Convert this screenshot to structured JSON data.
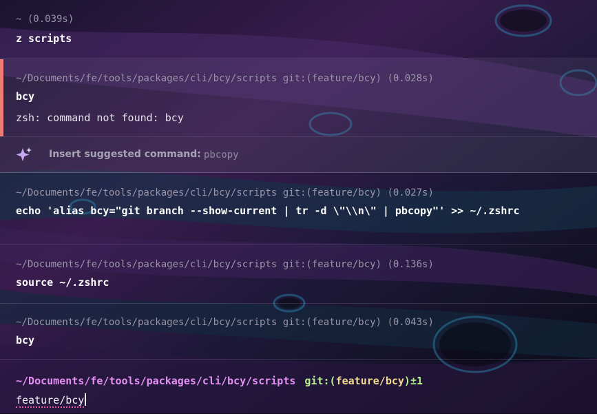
{
  "blocks": [
    {
      "meta": "~ (0.039s)",
      "command": "z scripts"
    },
    {
      "meta": "~/Documents/fe/tools/packages/cli/bcy/scripts git:(feature/bcy) (0.028s)",
      "command": "bcy",
      "output": "zsh: command not found: bcy"
    },
    {
      "meta": "~/Documents/fe/tools/packages/cli/bcy/scripts git:(feature/bcy) (0.027s)",
      "command": "echo 'alias bcy=\"git branch --show-current | tr -d \\\"\\\\n\\\" | pbcopy\"' >> ~/.zshrc"
    },
    {
      "meta": "~/Documents/fe/tools/packages/cli/bcy/scripts git:(feature/bcy) (0.136s)",
      "command": "source ~/.zshrc"
    },
    {
      "meta": "~/Documents/fe/tools/packages/cli/bcy/scripts git:(feature/bcy) (0.043s)",
      "command": "bcy"
    }
  ],
  "suggestion": {
    "label": "Insert suggested command:",
    "command": "pbcopy",
    "icon": "sparkles-icon"
  },
  "prompt": {
    "path": "~/Documents/fe/tools/packages/cli/bcy/scripts",
    "git_prefix": "git:(",
    "branch": "feature/bcy",
    "git_suffix": ")",
    "dirty": "±1"
  },
  "input": {
    "value": "feature/bcy"
  },
  "colors": {
    "error_accent": "#ef7c74",
    "prompt_path": "#e58ff2",
    "prompt_git": "#b8ee8f",
    "prompt_branch": "#f3d98e"
  }
}
